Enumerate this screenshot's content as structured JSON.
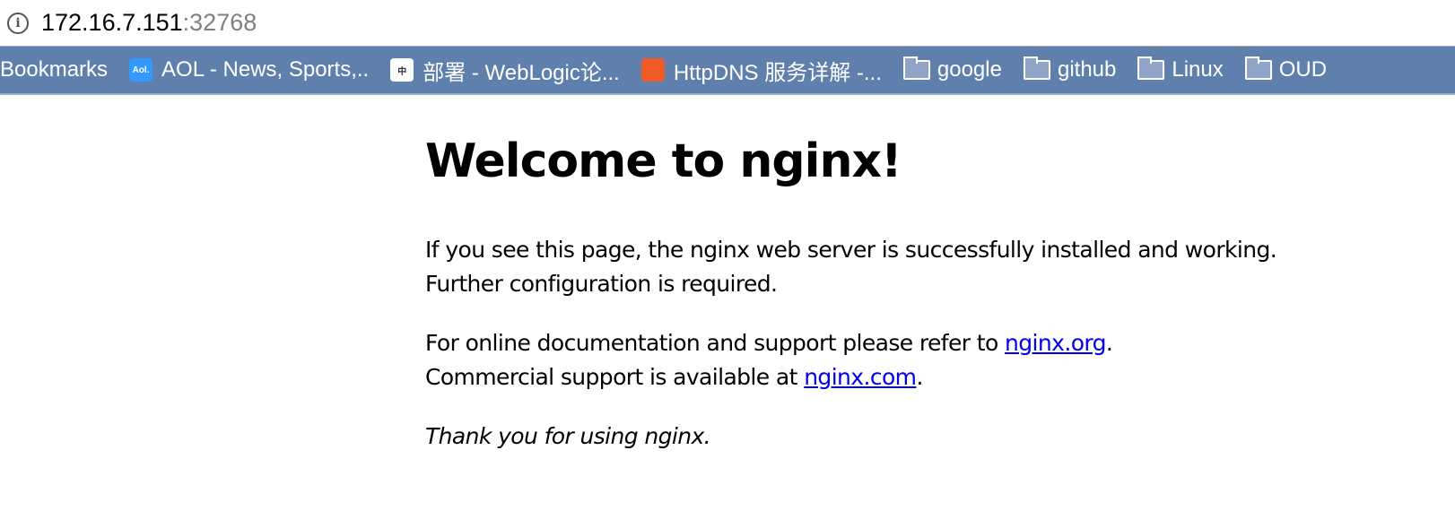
{
  "address": {
    "host": "172.16.7.151",
    "port": ":32768",
    "icon": "info-icon"
  },
  "bookmarks": [
    {
      "label": "Bookmarks",
      "type": "text"
    },
    {
      "label": "AOL - News, Sports,..",
      "type": "site",
      "icon_text": "Aol.",
      "color": "#3399ff"
    },
    {
      "label": "部署 - WebLogic论...",
      "type": "site",
      "icon_text": "中",
      "color": "#ffffff"
    },
    {
      "label": "HttpDNS 服务详解 -...",
      "type": "site",
      "icon_text": "",
      "color": "#f05a28"
    },
    {
      "label": "google",
      "type": "folder"
    },
    {
      "label": "github",
      "type": "folder"
    },
    {
      "label": "Linux",
      "type": "folder"
    },
    {
      "label": "OUD",
      "type": "folder"
    }
  ],
  "page": {
    "title": "Welcome to nginx!",
    "p1": "If you see this page, the nginx web server is successfully installed and working. Further configuration is required.",
    "p2a": "For online documentation and support please refer to ",
    "link1": "nginx.org",
    "p2b": ".",
    "p2c": "Commercial support is available at ",
    "link2": "nginx.com",
    "p2d": ".",
    "p3": "Thank you for using nginx."
  }
}
